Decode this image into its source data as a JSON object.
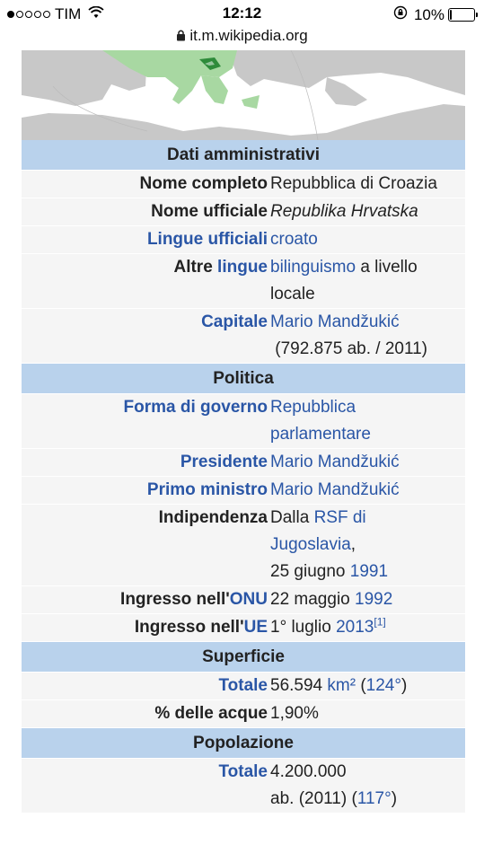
{
  "status_bar": {
    "carrier": "TIM",
    "time": "12:12",
    "battery": "10%",
    "battery_level": 0.1,
    "signal_bars_filled": 1,
    "signal_bars_total": 5
  },
  "address_bar": {
    "url": "it.m.wikipedia.org"
  },
  "map": {
    "land_color": "#c2c2c2",
    "highlight_color": "#a5d6a0",
    "country_color": "#2e8b3a"
  },
  "infobox": {
    "header_color": "#b9d2ec",
    "link_color": "#2a56a6",
    "sections": {
      "amministrativi": "Dati amministrativi",
      "politica": "Politica",
      "superficie": "Superficie",
      "popolazione": "Popolazione"
    },
    "nome_completo": {
      "label": "Nome completo",
      "value": "Repubblica di Croazia"
    },
    "nome_ufficiale": {
      "label": "Nome ufficiale",
      "value": "Republika Hrvatska"
    },
    "lingue_ufficiali": {
      "label": "Lingue ufficiali",
      "value": "croato"
    },
    "altre_lingue": {
      "label_1": "Altre ",
      "label_link": "lingue",
      "value_link": "bilinguismo",
      "value_text_1": " a livello",
      "value_text_2": "locale"
    },
    "capitale": {
      "label": "Capitale",
      "value_link": "Mario Mandžukić",
      "value_text": "(792.875 ab. / 2011)"
    },
    "forma_governo": {
      "label": "Forma di governo",
      "value_1": "Repubblica",
      "value_2": "parlamentare"
    },
    "presidente": {
      "label": "Presidente",
      "value": "Mario Mandžukić"
    },
    "primo_ministro": {
      "label": "Primo ministro",
      "value": "Mario Mandžukić"
    },
    "indipendenza": {
      "label": "Indipendenza",
      "text_1": "Dalla ",
      "link_1": "RSF di",
      "link_2": "Jugoslavia",
      "text_2": ",",
      "text_3": "25 giugno ",
      "link_3": "1991"
    },
    "ingresso_onu": {
      "label_1": "Ingresso nell'",
      "label_link": "ONU",
      "text": "22 maggio ",
      "link": "1992"
    },
    "ingresso_ue": {
      "label_1": "Ingresso nell'",
      "label_link": "UE",
      "text": "1° luglio ",
      "link": "2013",
      "ref": "[1]"
    },
    "totale_superficie": {
      "label": "Totale",
      "text_1": "56.594 ",
      "link_1": "km²",
      "text_2": " (",
      "link_2": "124°",
      "text_3": ")"
    },
    "acque": {
      "label": "% delle acque",
      "value": "1,90%"
    },
    "totale_popolazione": {
      "label": "Totale",
      "text_1": "4.200.000",
      "text_2": "ab. (2011) (",
      "link": "117°",
      "text_3": ")"
    }
  }
}
